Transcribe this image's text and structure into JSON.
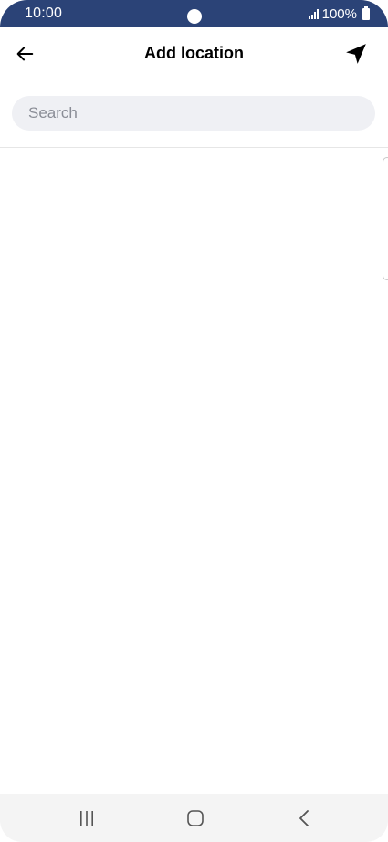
{
  "status_bar": {
    "time": "10:00",
    "battery": "100%"
  },
  "header": {
    "title": "Add location",
    "back_icon": "arrow-left-icon",
    "locate_icon": "location-arrow-icon"
  },
  "search": {
    "placeholder": "Search",
    "value": ""
  },
  "nav_bar": {
    "recents_icon": "recents-icon",
    "home_icon": "home-icon",
    "back_icon": "chevron-left-icon"
  },
  "colors": {
    "status_bar_bg": "#2b4377",
    "search_bg": "#eff0f4",
    "nav_bar_bg": "#f4f4f4"
  }
}
